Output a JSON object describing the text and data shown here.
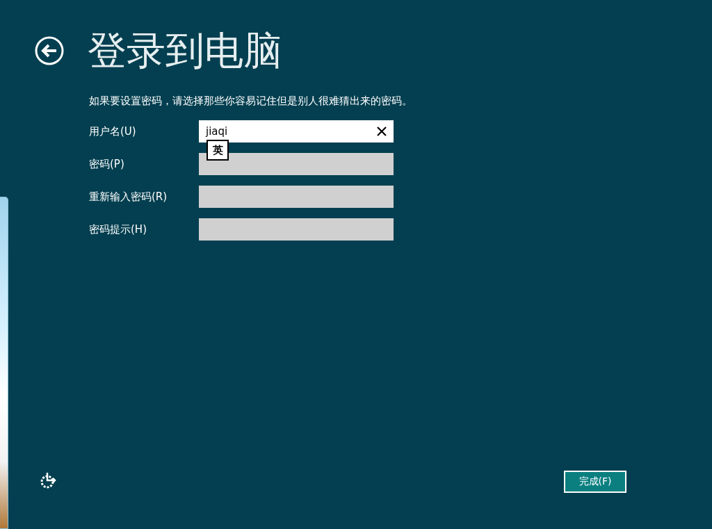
{
  "title": "登录到电脑",
  "description": "如果要设置密码，请选择那些你容易记住但是别人很难猜出来的密码。",
  "fields": [
    {
      "label": "用户名(U)",
      "value": "jiaqi",
      "focused": true
    },
    {
      "label": "密码(P)",
      "focused": false
    },
    {
      "label": "重新输入密码(R)",
      "focused": false
    },
    {
      "label": "密码提示(H)",
      "focused": false
    }
  ],
  "ime_indicator": "英",
  "finish_button": "完成(F)"
}
